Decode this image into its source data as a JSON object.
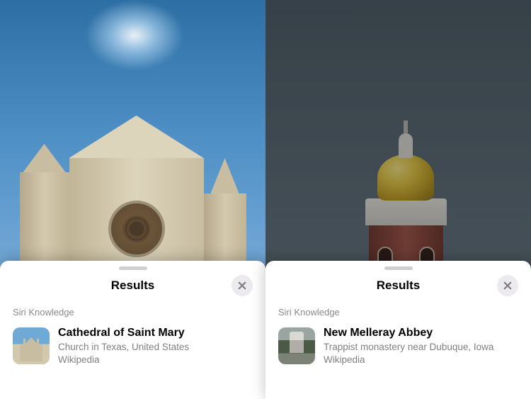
{
  "panels": [
    {
      "sheet_title": "Results",
      "section_label": "Siri Knowledge",
      "result": {
        "title": "Cathedral of Saint Mary",
        "subtitle": "Church in Texas, United States",
        "source": "Wikipedia"
      }
    },
    {
      "sheet_title": "Results",
      "section_label": "Siri Knowledge",
      "result": {
        "title": "New Melleray Abbey",
        "subtitle": "Trappist monastery near Dubuque, Iowa",
        "source": "Wikipedia"
      }
    }
  ]
}
